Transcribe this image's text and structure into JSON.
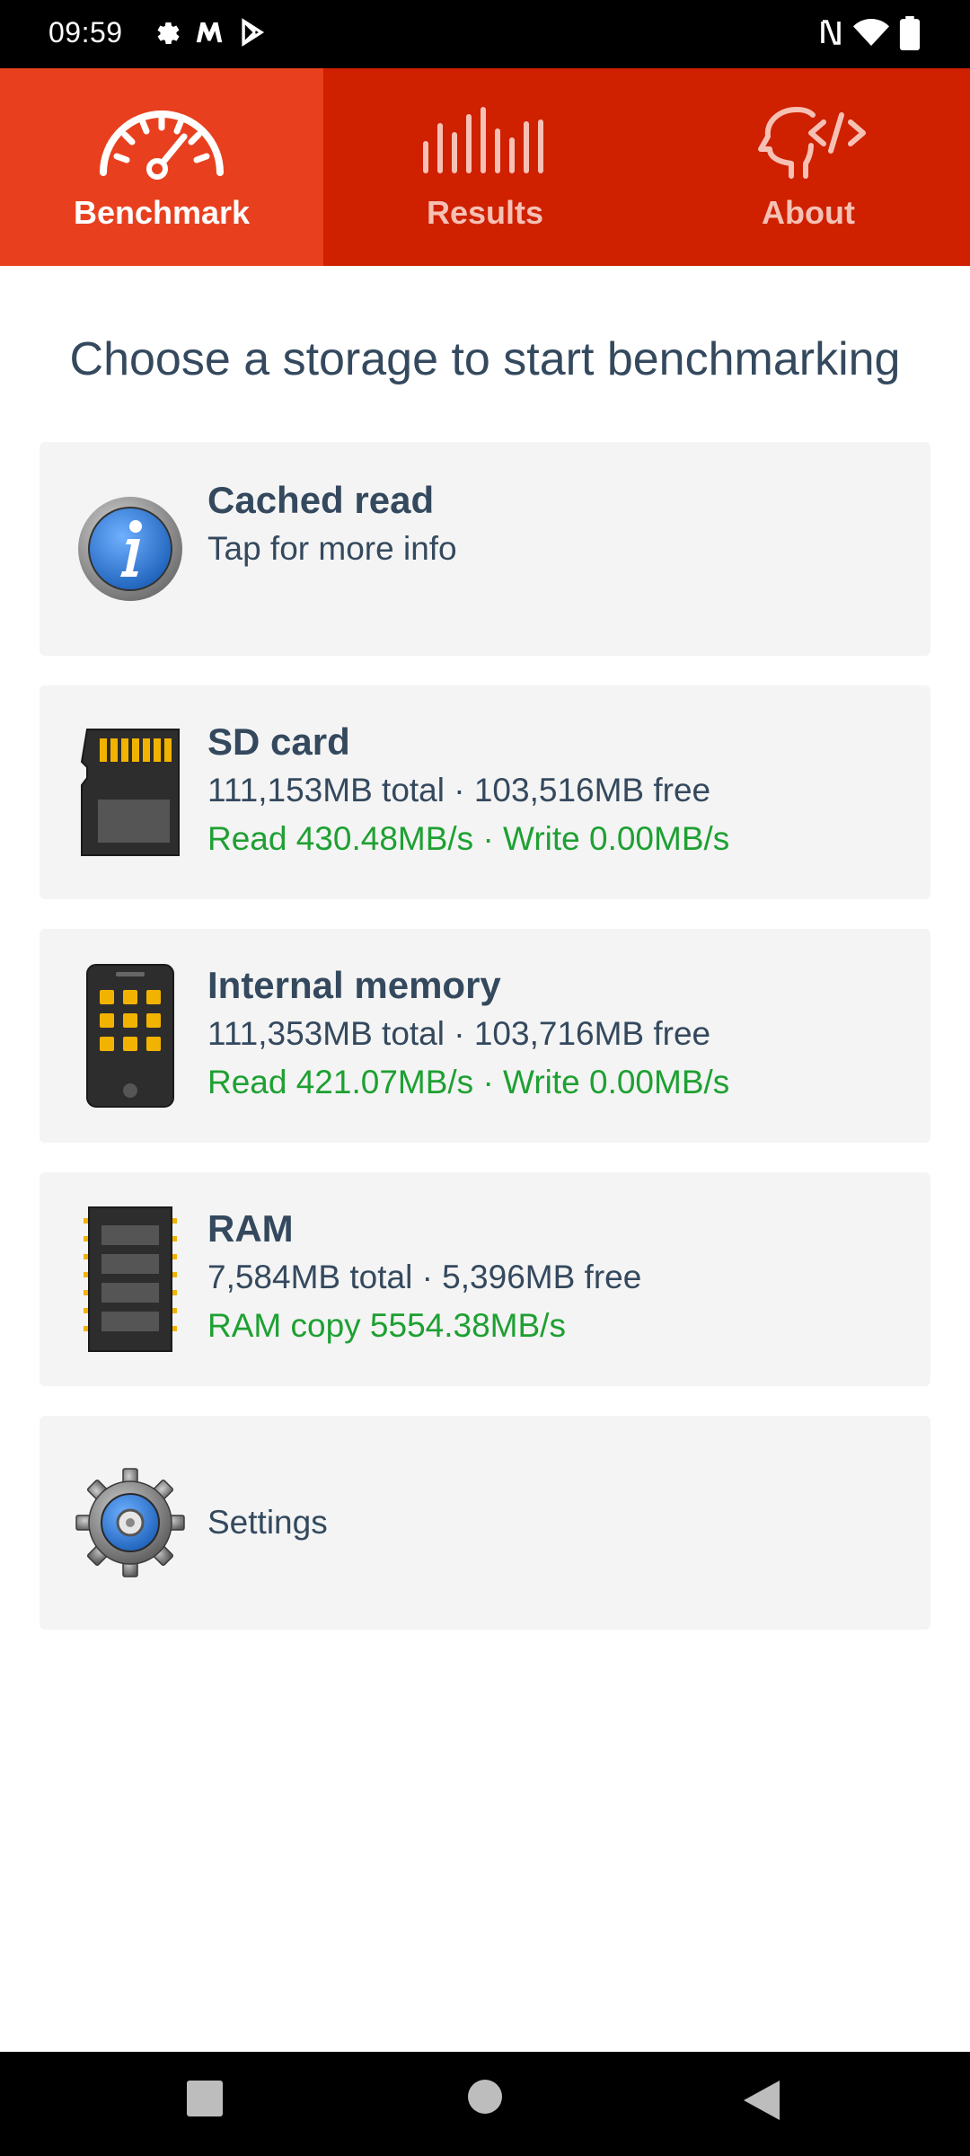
{
  "status_bar": {
    "time": "09:59",
    "left_icons": [
      "settings-icon",
      "m-logo-icon",
      "play-store-icon"
    ],
    "right_icons": [
      "nfc-icon",
      "wifi-icon",
      "battery-icon"
    ]
  },
  "tabs": [
    {
      "label": "Benchmark",
      "icon": "speedometer-icon",
      "active": true
    },
    {
      "label": "Results",
      "icon": "bars-icon",
      "active": false
    },
    {
      "label": "About",
      "icon": "head-code-icon",
      "active": false
    }
  ],
  "heading": "Choose a storage to start benchmarking",
  "cards": {
    "cached": {
      "title": "Cached read",
      "line1": "Tap for more info",
      "icon": "info-icon"
    },
    "sd": {
      "title": "SD card",
      "line1": "111,153MB total · 103,516MB free",
      "line2": "Read 430.48MB/s · Write 0.00MB/s",
      "icon": "sd-card-icon"
    },
    "internal": {
      "title": "Internal memory",
      "line1": "111,353MB total · 103,716MB free",
      "line2": "Read 421.07MB/s · Write 0.00MB/s",
      "icon": "phone-memory-icon"
    },
    "ram": {
      "title": "RAM",
      "line1": "7,584MB total · 5,396MB free",
      "line2": "RAM copy 5554.38MB/s",
      "icon": "ram-chip-icon"
    },
    "settings": {
      "label": "Settings",
      "icon": "gear-icon"
    }
  },
  "colors": {
    "tab_bar": "#cf2000",
    "tab_active": "#e8401f",
    "text": "#34495e",
    "green": "#1ea032",
    "card_bg": "#f4f4f4"
  },
  "nav_bar": [
    "recents-icon",
    "home-icon",
    "back-icon"
  ]
}
